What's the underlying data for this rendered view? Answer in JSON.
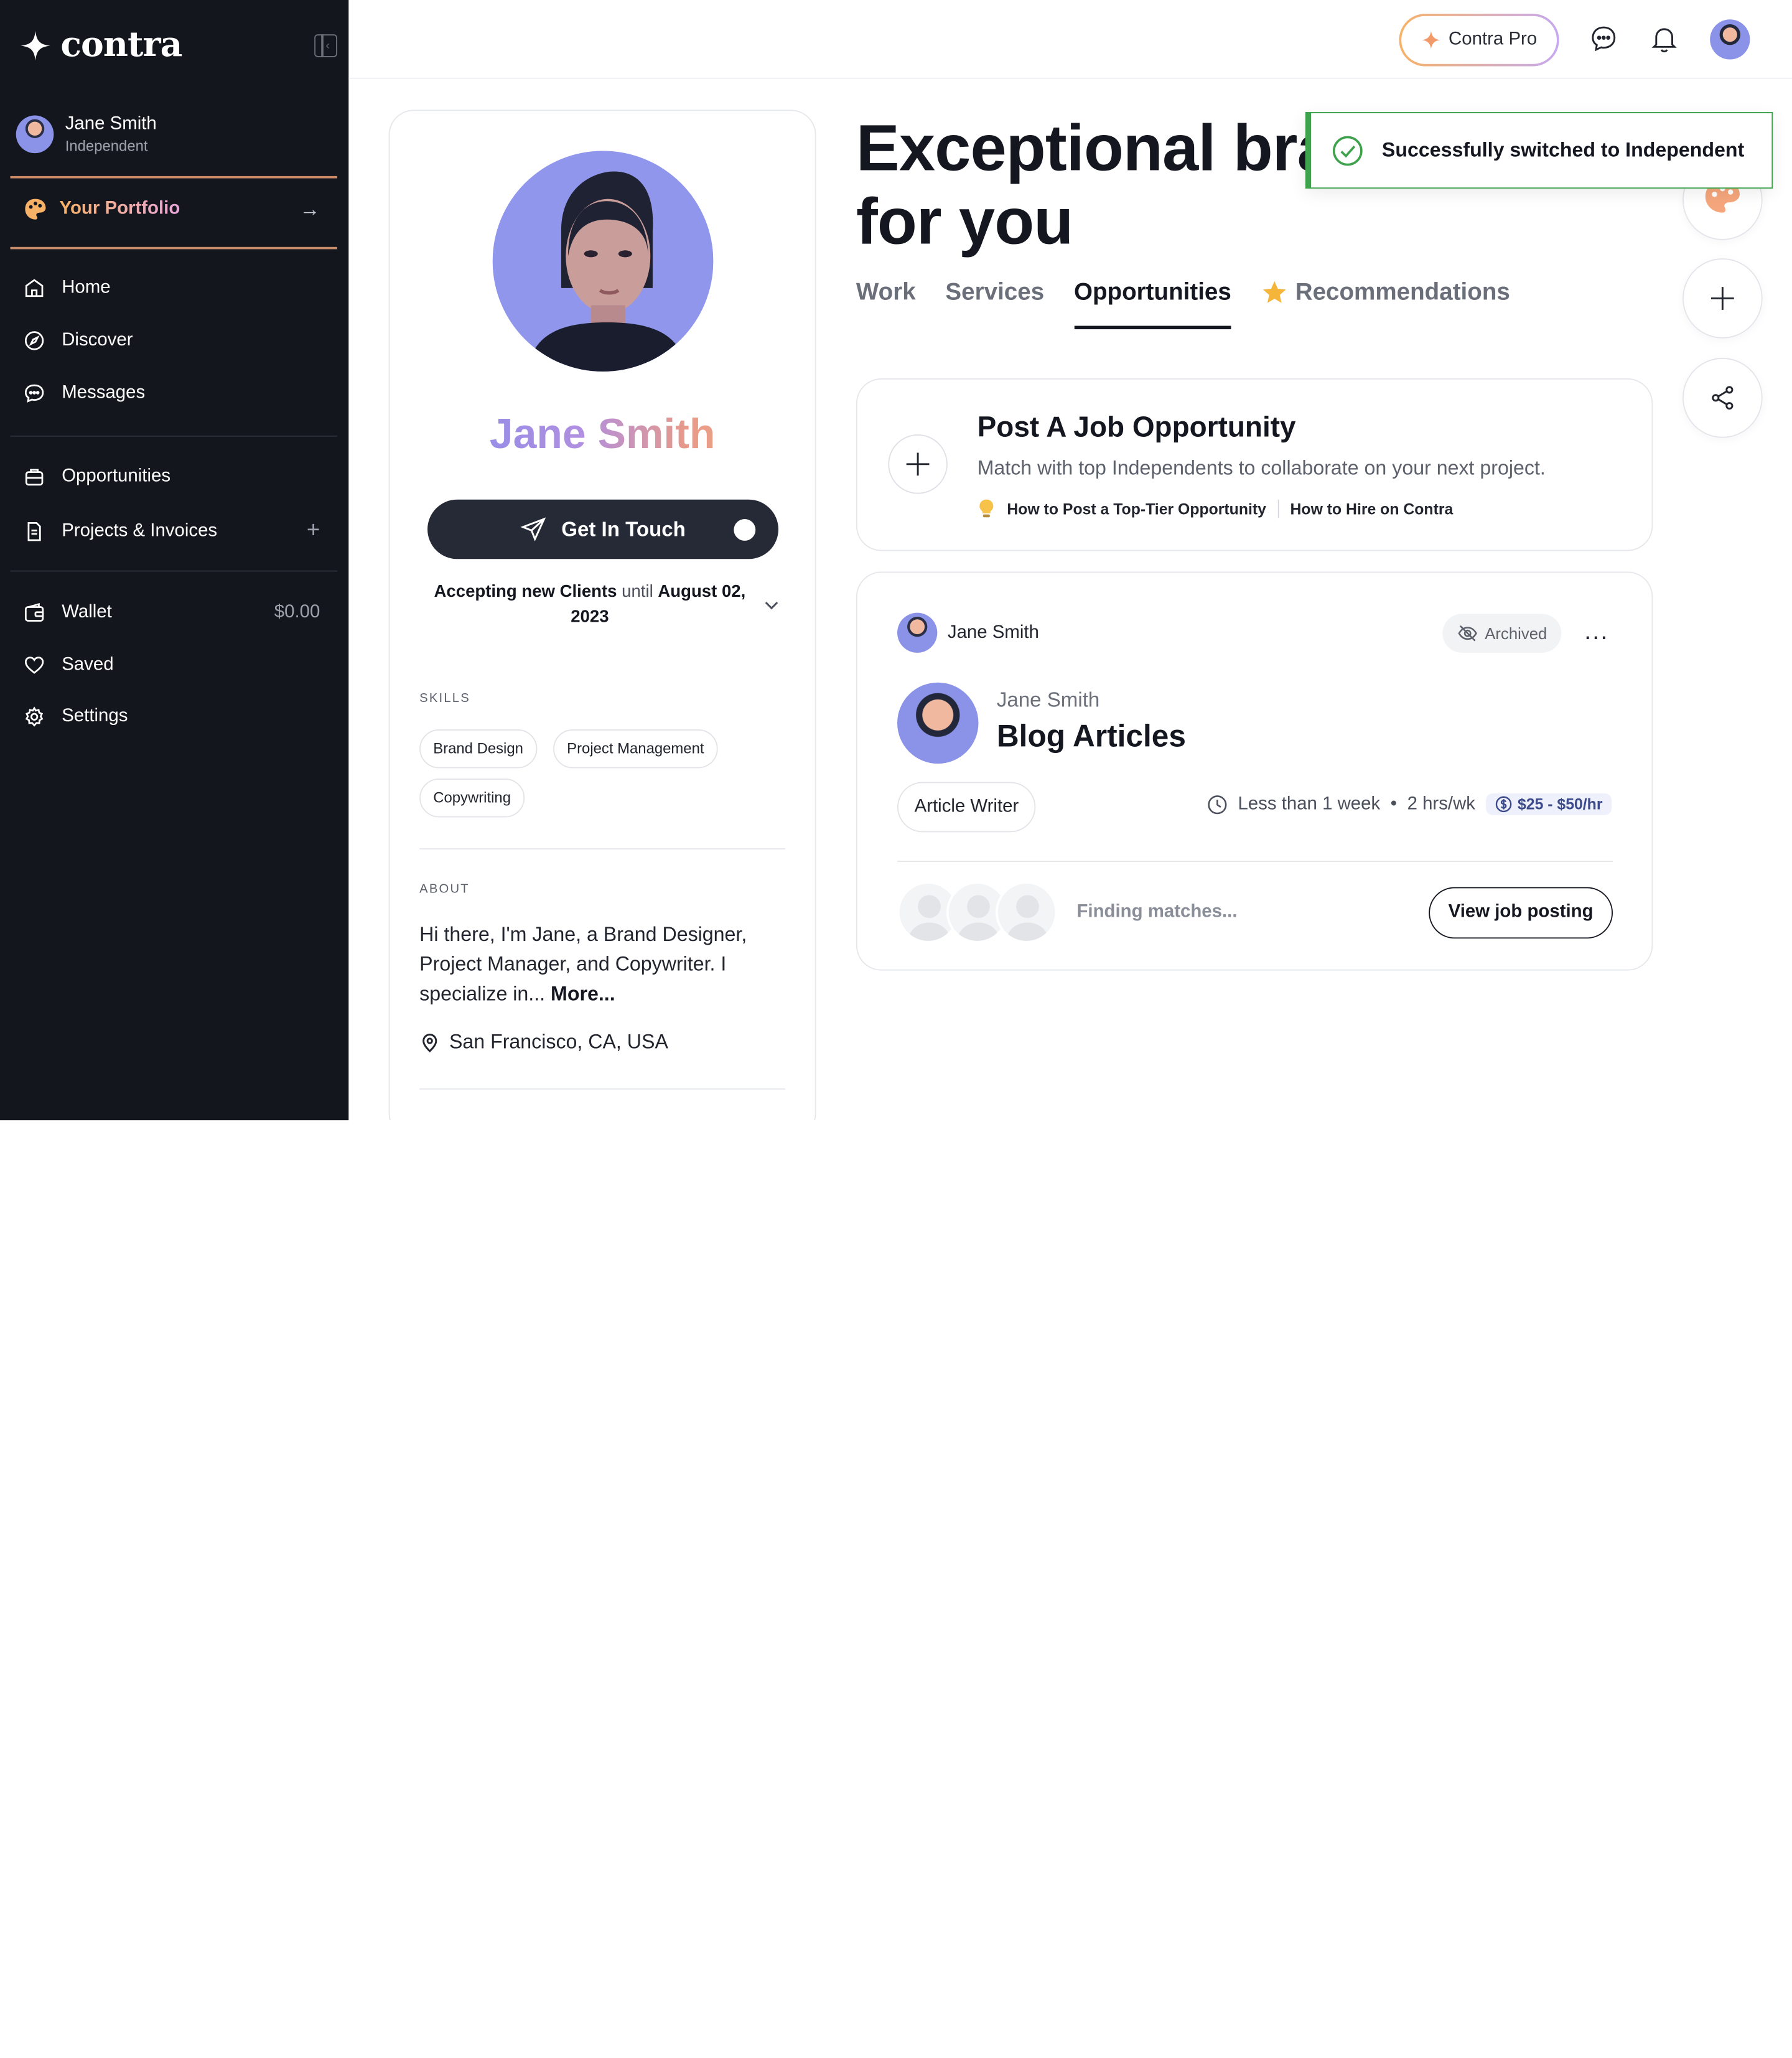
{
  "brand": {
    "name": "contra"
  },
  "sidebar": {
    "user": {
      "name": "Jane Smith",
      "status": "Independent"
    },
    "portfolio_label": "Your Portfolio",
    "items": [
      {
        "label": "Home",
        "icon": "home-icon"
      },
      {
        "label": "Discover",
        "icon": "compass-icon"
      },
      {
        "label": "Messages",
        "icon": "chat-icon"
      },
      {
        "label": "Opportunities",
        "icon": "briefcase-icon"
      },
      {
        "label": "Projects & Invoices",
        "icon": "document-icon",
        "extra": "+"
      },
      {
        "label": "Wallet",
        "icon": "wallet-icon",
        "extra": "$0.00"
      },
      {
        "label": "Saved",
        "icon": "heart-icon"
      },
      {
        "label": "Settings",
        "icon": "gear-icon"
      }
    ]
  },
  "topbar": {
    "pro_label": "Contra Pro"
  },
  "profile": {
    "first_name": "Jane",
    "last_name": "Smith",
    "get_in_touch": "Get In Touch",
    "accepting_prefix": "Accepting new Clients",
    "accepting_until": "until",
    "accepting_date": "August 02, 2023",
    "skills_label": "SKILLS",
    "skills": [
      "Brand Design",
      "Project Management",
      "Copywriting"
    ],
    "about_label": "ABOUT",
    "about_text": "Hi there, I'm Jane, a Brand Designer, Project Manager, and Copywriter. I specialize in...",
    "about_more": "More...",
    "location": "San Francisco, CA, USA"
  },
  "main": {
    "hero_line1": "Exceptional bra",
    "hero_line2": "for you",
    "tabs": [
      "Work",
      "Services",
      "Opportunities",
      "Recommendations"
    ],
    "active_tab": "Opportunities"
  },
  "toast": {
    "message": "Successfully switched to Independent"
  },
  "post_job": {
    "title": "Post A Job Opportunity",
    "subtitle": "Match with top Independents to collaborate on your next project.",
    "link1": "How to Post a Top-Tier Opportunity",
    "link2": "How to Hire on Contra"
  },
  "job": {
    "owner": "Jane Smith",
    "status": "Archived",
    "more": "...",
    "client": "Jane Smith",
    "title": "Blog Articles",
    "role": "Article Writer",
    "duration": "Less than 1 week",
    "hours": "2 hrs/wk",
    "rate": "$25 - $50/hr",
    "finding": "Finding matches...",
    "view_label": "View job posting"
  },
  "colors": {
    "sidebar_bg": "#14161e",
    "toast_green": "#3fa34d",
    "text": "#14171f"
  }
}
